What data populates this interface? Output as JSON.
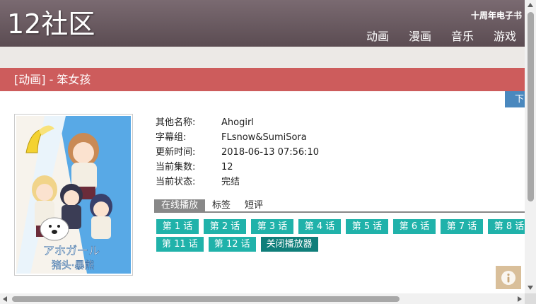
{
  "header": {
    "logo": "12社区",
    "ebook_link": "十周年电子书",
    "nav": [
      "动画",
      "漫画",
      "音乐",
      "游戏"
    ]
  },
  "page_title": "[动画] - 笨女孩",
  "download_tab": "下",
  "poster": {
    "caption_top": "アホガール",
    "caption_bottom": "猪头·暴熊"
  },
  "info": [
    {
      "label": "其他名称:",
      "value": "Ahogirl"
    },
    {
      "label": "字幕组:",
      "value": "FLsnow&SumiSora"
    },
    {
      "label": "更新时间:",
      "value": "2018-06-13 07:56:10"
    },
    {
      "label": "当前集数:",
      "value": "12"
    },
    {
      "label": "当前状态:",
      "value": "完结"
    }
  ],
  "tabs": [
    "在线播放",
    "标签",
    "短评"
  ],
  "episodes_row1": [
    "第 1 话",
    "第 2 话",
    "第 3 话",
    "第 4 话",
    "第 5 话",
    "第 6 话",
    "第 7 话",
    "第 8 话"
  ],
  "episodes_row2": [
    "第 11 话",
    "第 12 话"
  ],
  "close_player": "关闭播放器",
  "colors": {
    "header": "#6b5b61",
    "title_bar": "#cd5c5c",
    "episode_button": "#20b2aa",
    "close_button": "#0f7e7a",
    "download_tab": "#4a88be"
  },
  "icons": {
    "info_button": "info-icon"
  }
}
